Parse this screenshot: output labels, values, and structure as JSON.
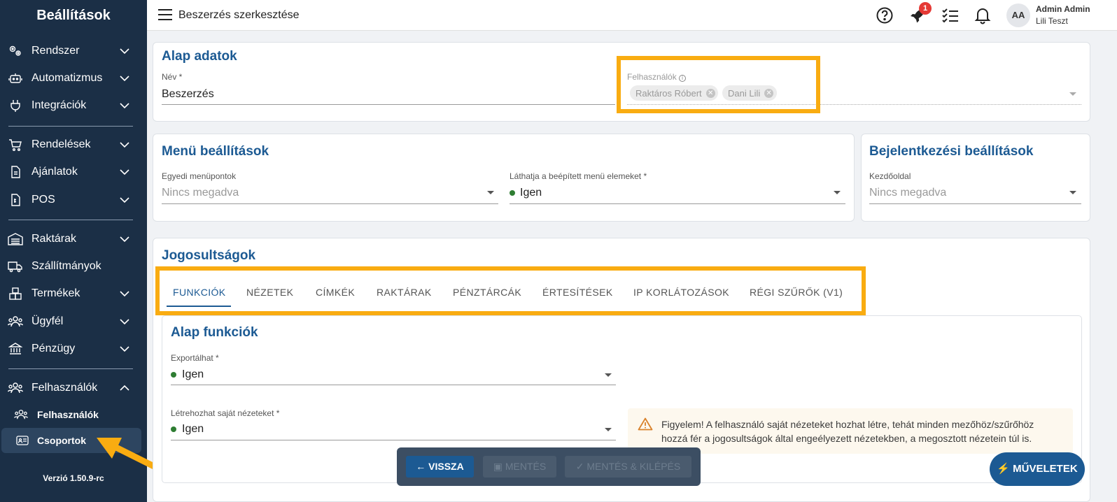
{
  "sidebar": {
    "title": "Beállítások",
    "items": [
      {
        "label": "Rendszer",
        "icon": "gears-icon"
      },
      {
        "label": "Automatizmus",
        "icon": "robot-icon"
      },
      {
        "label": "Integrációk",
        "icon": "plug-icon"
      },
      {
        "label": "Rendelések",
        "icon": "cart-icon"
      },
      {
        "label": "Ajánlatok",
        "icon": "document-icon"
      },
      {
        "label": "POS",
        "icon": "receipt-icon"
      },
      {
        "label": "Raktárak",
        "icon": "warehouse-icon"
      },
      {
        "label": "Szállítmányok",
        "icon": "truck-icon"
      },
      {
        "label": "Termékek",
        "icon": "boxes-icon"
      },
      {
        "label": "Ügyfél",
        "icon": "people-icon"
      },
      {
        "label": "Pénzügy",
        "icon": "bank-icon"
      },
      {
        "label": "Felhasználók",
        "icon": "users-icon"
      }
    ],
    "sub_items": [
      {
        "label": "Felhasználók",
        "icon": "users-icon"
      },
      {
        "label": "Csoportok",
        "icon": "group-card-icon"
      }
    ],
    "version": "Verzió 1.50.9-rc"
  },
  "topbar": {
    "title": "Beszerzés szerkesztése",
    "badge_count": "1",
    "avatar": "AA",
    "user_name": "Admin Admin",
    "user_org": "Lili Teszt"
  },
  "basic": {
    "title": "Alap adatok",
    "name_label": "Név *",
    "name_value": "Beszerzés",
    "users_label": "Felhasználók",
    "users": [
      "Raktáros Róbert",
      "Dani Lili"
    ]
  },
  "menu": {
    "title": "Menü beállítások",
    "custom_label": "Egyedi menüpontok",
    "custom_placeholder": "Nincs megadva",
    "builtin_label": "Láthatja a beépített menü elemeket *",
    "builtin_value": "Igen"
  },
  "login": {
    "title": "Bejelentkezési beállítások",
    "home_label": "Kezdőoldal",
    "home_placeholder": "Nincs megadva"
  },
  "permissions": {
    "title": "Jogosultságok",
    "tabs": [
      "FUNKCIÓK",
      "NÉZETEK",
      "CÍMKÉK",
      "RAKTÁRAK",
      "PÉNZTÁRCÁK",
      "ÉRTESÍTÉSEK",
      "IP KORLÁTOZÁSOK",
      "RÉGI SZŰRŐK (V1)"
    ],
    "active_tab": "FUNKCIÓK"
  },
  "functions": {
    "title": "Alap funkciók",
    "export_label": "Exportálhat *",
    "export_value": "Igen",
    "views_label": "Létrehozhat saját nézeteket *",
    "views_value": "Igen",
    "warning": "Figyelem! A felhasználó saját nézeteket hozhat létre, tehát minden mezőhöz/szűrőhöz hozzá fér a jogosultságok által engeélyezett nézetekben, a megosztott nézetein túl is."
  },
  "actions": {
    "back": "VISSZA",
    "save": "MENTÉS",
    "save_exit": "MENTÉS & KILÉPÉS",
    "operations": "MŰVELETEK"
  },
  "colors": {
    "accent": "#1c5a93",
    "sidebar": "#1b2f46",
    "highlight": "#f9ac11",
    "status_green": "#2e7d32"
  }
}
